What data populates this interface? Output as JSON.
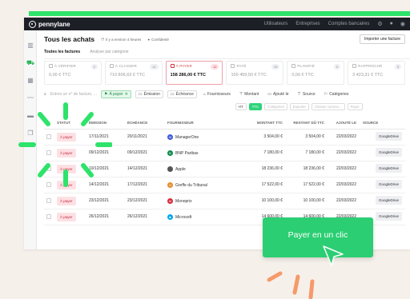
{
  "app": {
    "brand": "pennylane",
    "nav_links": [
      "Utilisateurs",
      "Entreprises",
      "Comptes bancaires"
    ]
  },
  "header": {
    "title": "Tous les achats",
    "subtitle_1": "Il y a environ 4 heures",
    "subtitle_2": "Confidenté",
    "import_button": "Importer une facture"
  },
  "tabs": [
    {
      "label": "Toutes les factures",
      "active": true
    },
    {
      "label": "Analyse par catégorie",
      "active": false
    }
  ],
  "cards": [
    {
      "label": "À VÉRIFIER",
      "count": "2",
      "amount": "0,00 € TTC"
    },
    {
      "label": "À CLASSER",
      "count": "12",
      "amount": "710 806,63 € TTC"
    },
    {
      "label": "À PAYER",
      "count": "12",
      "amount": "158 286,00 € TTC",
      "selected": true
    },
    {
      "label": "PAYÉ",
      "count": "10",
      "amount": "100 459,50 € TTC"
    },
    {
      "label": "PLANIFIÉ",
      "count": "0",
      "amount": "0,00 € TTC"
    },
    {
      "label": "RAPPROCHÉ",
      "count": "3",
      "amount": "3 423,31 € TTC"
    }
  ],
  "filters": {
    "search_placeholder": "Entrez un n° de facture, ...",
    "active_filter": "À payer",
    "chips": [
      "Émission",
      "Échéance",
      "Fournisseurs",
      "Montant",
      "Ajouté le",
      "Source",
      "Catégories"
    ]
  },
  "filters2": {
    "segments": [
      "HT",
      "TTC"
    ],
    "others": [
      "Catégories",
      "Exporter",
      "Classer comme...",
      "Payer"
    ]
  },
  "table": {
    "headers": {
      "statut": "STATUT",
      "emission": "ÉMISSION",
      "echeance": "ÉCHÉANCE",
      "fournisseur": "FOURNISSEUR",
      "montant_ttc": "MONTANT TTC",
      "restant_du": "RESTANT DÛ TTC",
      "ajoute_le": "AJOUTÉ LE",
      "source": "SOURCE"
    },
    "rows": [
      {
        "statut": "À payer",
        "emission": "17/11/2021",
        "echeance": "20/11/2021",
        "fournisseur": "ManagerOne",
        "montant": "3 504,00 €",
        "restant": "3 504,00 €",
        "ajoute": "22/03/2022",
        "source": "GoogleDrive",
        "icon_color": "#3b5bdb",
        "icon": "M"
      },
      {
        "statut": "À payer",
        "emission": "09/12/2021",
        "echeance": "09/12/2021",
        "fournisseur": "BNP Paribas",
        "montant": "7 180,00 €",
        "restant": "7 180,00 €",
        "ajoute": "22/03/2022",
        "source": "GoogleDrive",
        "icon_color": "#0b8a4a",
        "icon": "B"
      },
      {
        "statut": "À payer",
        "emission": "10/12/2021",
        "echeance": "14/12/2021",
        "fournisseur": "Apple",
        "montant": "18 236,00 €",
        "restant": "18 236,00 €",
        "ajoute": "22/03/2022",
        "source": "GoogleDrive",
        "icon_color": "#555555",
        "icon": ""
      },
      {
        "statut": "À payer",
        "emission": "14/12/2021",
        "echeance": "17/12/2021",
        "fournisseur": "Greffe du Tribunal",
        "montant": "17 522,00 €",
        "restant": "17 522,00 €",
        "ajoute": "22/03/2022",
        "source": "GoogleDrive",
        "icon_color": "#e8892b",
        "icon": "G"
      },
      {
        "statut": "À payer",
        "emission": "23/12/2021",
        "echeance": "23/12/2021",
        "fournisseur": "Monoprix",
        "montant": "10 100,00 €",
        "restant": "10 100,00 €",
        "ajoute": "22/03/2022",
        "source": "GoogleDrive",
        "icon_color": "#d62839",
        "icon": "M"
      },
      {
        "statut": "À payer",
        "emission": "26/12/2021",
        "echeance": "26/12/2021",
        "fournisseur": "Microsoft",
        "montant": "14 600,00 €",
        "restant": "14 600,00 €",
        "ajoute": "22/03/2022",
        "source": "GoogleDrive",
        "icon_color": "#00a4ef",
        "icon": "■"
      }
    ]
  },
  "cta": {
    "label": "Payer en un clic"
  },
  "colors": {
    "accent_green": "#2bce72",
    "burst_green": "#2ee36a",
    "status_red": "#c42a3d",
    "orange": "#f59a6a"
  },
  "icons": [
    "logo-icon",
    "gear-icon",
    "bell-icon",
    "user-icon",
    "building-icon",
    "cart-icon",
    "chart-icon",
    "folder-icon",
    "search-icon",
    "calendar-icon",
    "filter-icon",
    "cursor-icon"
  ]
}
